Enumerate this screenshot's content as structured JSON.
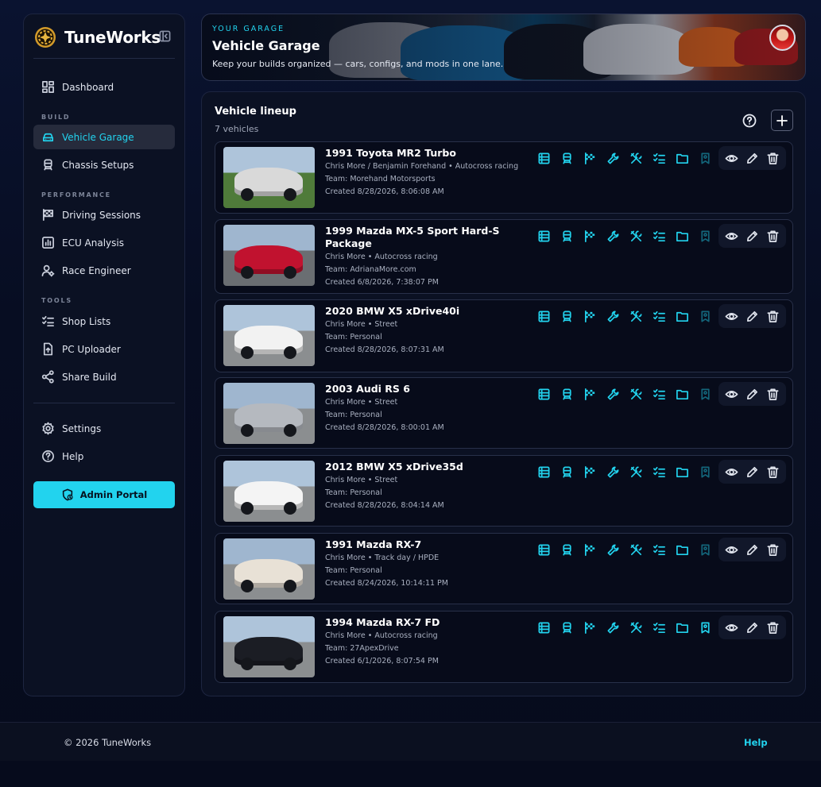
{
  "app": {
    "name": "TuneWorks"
  },
  "sidebar": {
    "dashboard": "Dashboard",
    "sections": {
      "build": "BUILD",
      "performance": "PERFORMANCE",
      "tools": "TOOLS"
    },
    "items": [
      {
        "label": "Vehicle Garage",
        "icon": "car-icon"
      },
      {
        "label": "Chassis Setups",
        "icon": "chassis-icon"
      },
      {
        "label": "Driving Sessions",
        "icon": "checkered-flag-icon"
      },
      {
        "label": "ECU Analysis",
        "icon": "chart-icon"
      },
      {
        "label": "Race Engineer",
        "icon": "engineer-icon"
      },
      {
        "label": "Shop Lists",
        "icon": "checklist-icon"
      },
      {
        "label": "PC Uploader",
        "icon": "upload-icon"
      },
      {
        "label": "Share Build",
        "icon": "share-icon"
      },
      {
        "label": "Settings",
        "icon": "gear-icon"
      },
      {
        "label": "Help",
        "icon": "help-icon"
      }
    ],
    "admin_label": "Admin Portal"
  },
  "hero": {
    "eyebrow": "YOUR GARAGE",
    "title": "Vehicle Garage",
    "subtitle": "Keep your builds organized — cars, configs, and mods in one lane."
  },
  "panel": {
    "title": "Vehicle lineup",
    "count": "7 vehicles"
  },
  "vehicles": [
    {
      "name": "1991 Toyota MR2 Turbo",
      "meta": "Chris More / Benjamin Forehand • Autocross racing",
      "team": "Team: Morehand Motorsports",
      "created": "Created 8/28/2026, 8:06:08 AM",
      "color": "#d9d9d9"
    },
    {
      "name": "1999 Mazda MX-5 Sport Hard-S Package",
      "meta": "Chris More • Autocross racing",
      "team": "Team: AdrianaMore.com",
      "created": "Created 6/8/2026, 7:38:07 PM",
      "color": "#c1122f"
    },
    {
      "name": "2020 BMW X5 xDrive40i",
      "meta": "Chris More • Street",
      "team": "Team: Personal",
      "created": "Created 8/28/2026, 8:07:31 AM",
      "color": "#f2f2f2"
    },
    {
      "name": "2003 Audi RS 6",
      "meta": "Chris More • Street",
      "team": "Team: Personal",
      "created": "Created 8/28/2026, 8:00:01 AM",
      "color": "#b5b9bf"
    },
    {
      "name": "2012 BMW X5 xDrive35d",
      "meta": "Chris More • Street",
      "team": "Team: Personal",
      "created": "Created 8/28/2026, 8:04:14 AM",
      "color": "#f4f4f4"
    },
    {
      "name": "1991 Mazda RX-7",
      "meta": "Chris More • Track day / HPDE",
      "team": "Team: Personal",
      "created": "Created 8/24/2026, 10:14:11 PM",
      "color": "#e8e1d6"
    },
    {
      "name": "1994 Mazda RX-7 FD",
      "meta": "Chris More • Autocross racing",
      "team": "Team: 27ApexDrive",
      "created": "Created 6/1/2026, 8:07:54 PM",
      "color": "#1b1d24"
    }
  ],
  "footer": {
    "copyright": "© 2026 TuneWorks",
    "help": "Help"
  },
  "colors": {
    "accent": "#22d3ee",
    "background": "#070d22",
    "panel": "#0b1123"
  }
}
